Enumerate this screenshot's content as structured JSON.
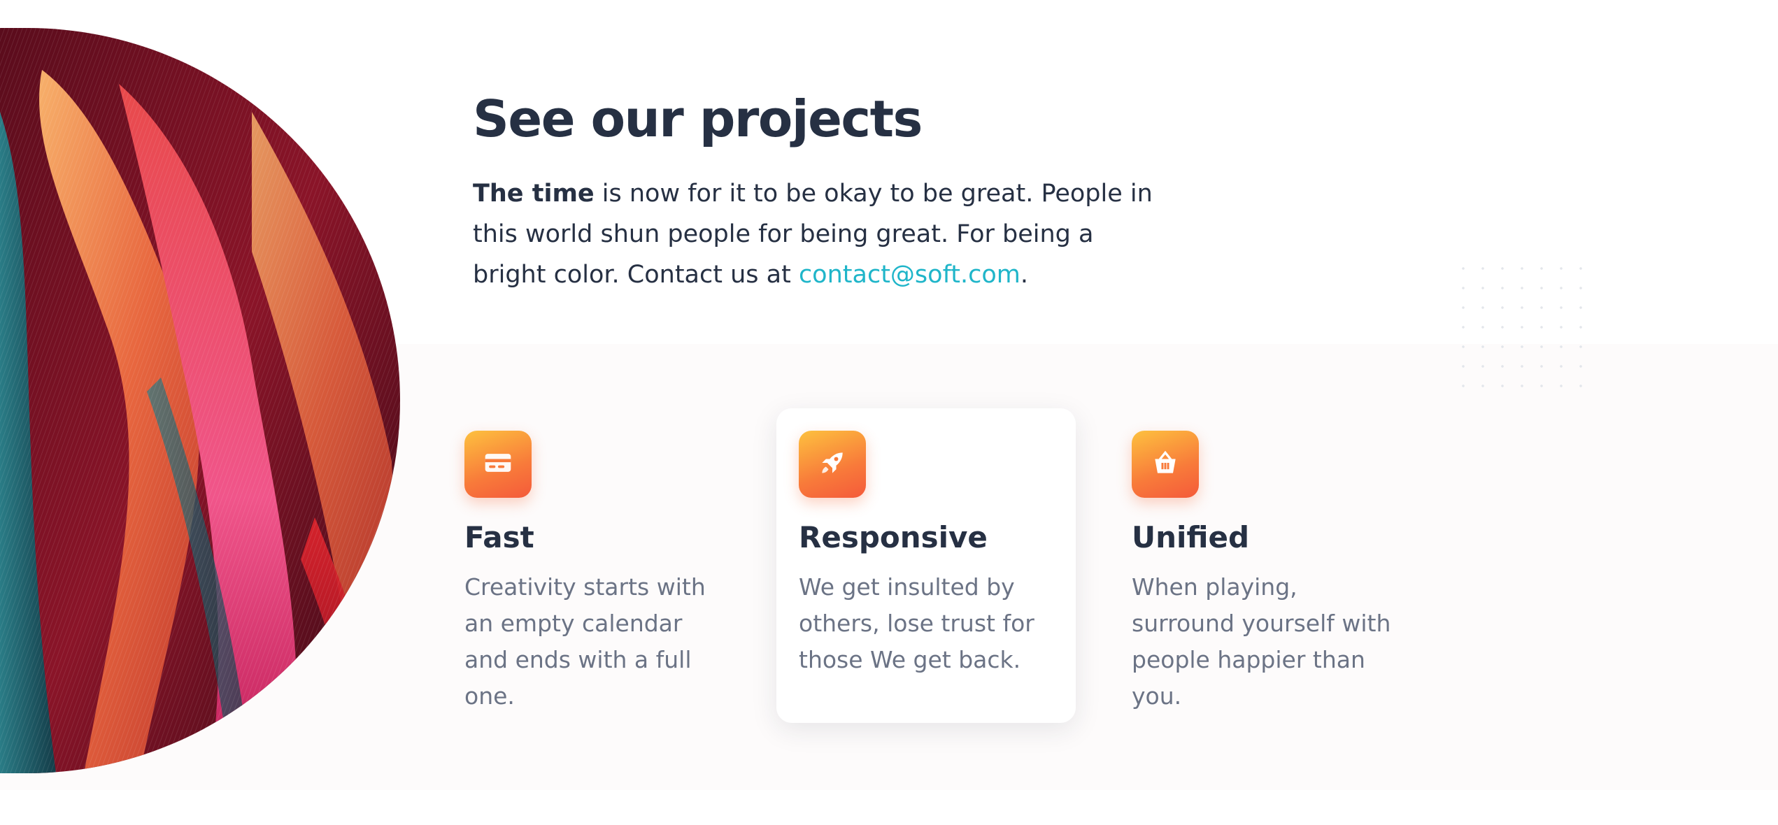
{
  "hero": {
    "title": "See our projects",
    "intro_bold": "The time",
    "intro_text": " is now for it to be okay to be great. People in this world shun people for being great. For being a bright color. Contact us at ",
    "contact_email": "contact@soft.com",
    "intro_end": "."
  },
  "features": [
    {
      "icon": "credit-card-icon",
      "title": "Fast",
      "description": "Creativity starts with an empty calendar and ends with a full one."
    },
    {
      "icon": "rocket-icon",
      "title": "Responsive",
      "description": "We get insulted by others, lose trust for those We get back."
    },
    {
      "icon": "shopping-basket-icon",
      "title": "Unified",
      "description": "When playing, surround yourself with people happier than you."
    }
  ],
  "colors": {
    "heading": "#263043",
    "body_text": "#6b7385",
    "link": "#1fb5c9",
    "icon_gradient_start": "#fdc13f",
    "icon_gradient_end": "#f45a3a"
  }
}
